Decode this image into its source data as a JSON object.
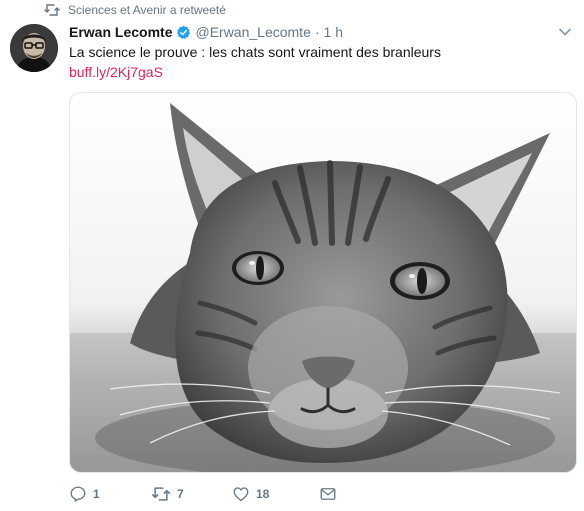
{
  "context": {
    "retweeter_label": "Sciences et Avenir a retweeté",
    "icon": "retweet-icon"
  },
  "tweet": {
    "author": {
      "name": "Erwan Lecomte",
      "handle": "@Erwan_Lecomte",
      "verified": true,
      "verified_icon": "verified-badge-icon",
      "avatar_icon": "avatar-photo"
    },
    "separator": "·",
    "time": "1 h",
    "text": "La science le prouve : les chats sont vraiment des branleurs",
    "link": "buff.ly/2Kj7gaS",
    "link_color": "#e0245e",
    "media": {
      "icon": "cat-photo"
    },
    "menu_icon": "chevron-down-icon"
  },
  "actions": {
    "reply": {
      "icon": "reply-icon",
      "count": "1"
    },
    "retweet": {
      "icon": "retweet-icon",
      "count": "7"
    },
    "like": {
      "icon": "heart-icon",
      "count": "18"
    },
    "message": {
      "icon": "envelope-icon"
    }
  },
  "colors": {
    "muted": "#657786",
    "verified": "#1da1f2",
    "text": "#14171a"
  }
}
